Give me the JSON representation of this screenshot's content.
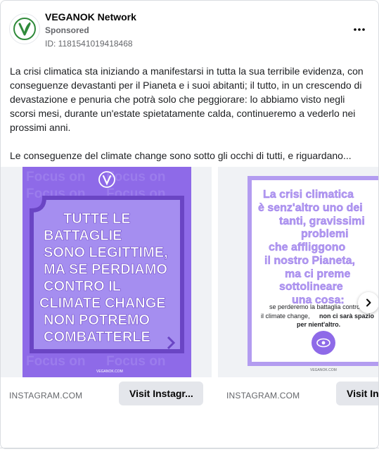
{
  "post": {
    "page_name": "VEGANOK Network",
    "sponsored": "Sponsored",
    "ad_id": "ID: 1181541019418468",
    "paragraph_1": "La crisi climatica sta iniziando a manifestarsi in tutta la sua terribile evidenza, con conseguenze devastanti per il Pianeta e i suoi abitanti; il tutto, in un crescendo di devastazione e penuria che potrà solo che peggiorare: lo abbiamo visto negli scorsi mesi, durante un'estate spietatamente calda, continueremo a vederlo nei prossimi anni.",
    "paragraph_2": "Le conseguenze del climate change sono sotto gli occhi di tutti, e riguardano...",
    "icons": {
      "avatar": "veganok-logo",
      "more": "more-options-icon",
      "next": "chevron-right-icon"
    }
  },
  "carousel": {
    "slides": [
      {
        "bg_text": "Focus on",
        "headline": [
          "TUTTE LE",
          "BATTAGLIE",
          "SONO LEGITTIME,",
          "MA SE PERDIAMO",
          "CONTRO IL",
          "CLIMATE CHANGE",
          "NON POTREMO",
          "COMBATTERLE"
        ],
        "footer": "VEGANOK.COM",
        "domain": "INSTAGRAM.COM",
        "cta": "Visit Instagr..."
      },
      {
        "headline": [
          "La crisi climatica",
          "è senz'altro uno dei",
          "tanti, gravissimi",
          "problemi",
          "che affliggono",
          "il nostro Pianeta,",
          "ma ci preme",
          "sottolineare",
          "una cosa:"
        ],
        "subtext_1": "se perderemo la battaglia contro",
        "subtext_2": "il climate change,",
        "subtext_bold": "non ci sarà spazio",
        "subtext_3": "per nient'altro.",
        "footer": "VEGANOK.COM",
        "domain": "INSTAGRAM.COM",
        "cta": "Visit Instagram"
      }
    ]
  },
  "colors": {
    "brand_purple": "#8e6ae8",
    "frame_purple": "#6a45c4",
    "lavender": "#b39cf0",
    "logo_green": "#2f8a3a"
  }
}
